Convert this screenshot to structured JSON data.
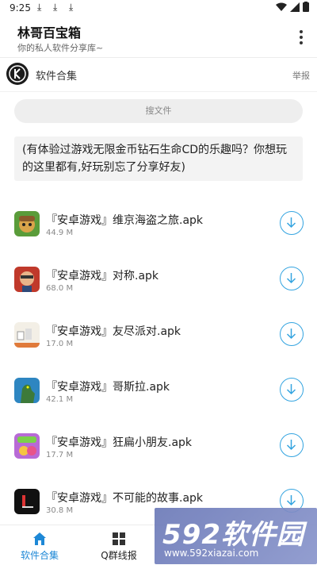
{
  "status_bar": {
    "time": "9:25"
  },
  "app": {
    "title": "林哥百宝箱",
    "subtitle": "你的私人软件分享库~"
  },
  "source": {
    "label": "软件合集",
    "report": "举报"
  },
  "search": {
    "placeholder": "搜文件"
  },
  "description": "(有体验过游戏无限金币钻石生命CD的乐趣吗？你想玩的这里都有,好玩别忘了分享好友)",
  "files": [
    {
      "name": "『安卓游戏』维京海盗之旅.apk",
      "size": "44.9 M",
      "icon": "viking-game-icon"
    },
    {
      "name": "『安卓游戏』对称.apk",
      "size": "68.0 M",
      "icon": "symmetry-game-icon"
    },
    {
      "name": "『安卓游戏』友尽派对.apk",
      "size": "17.0 M",
      "icon": "party-game-icon"
    },
    {
      "name": "『安卓游戏』哥斯拉.apk",
      "size": "42.1 M",
      "icon": "godzilla-game-icon"
    },
    {
      "name": "『安卓游戏』狂扁小朋友.apk",
      "size": "17.7 M",
      "icon": "kids-game-icon"
    },
    {
      "name": "『安卓游戏』不可能的故事.apk",
      "size": "30.8 M",
      "icon": "impossible-story-game-icon"
    }
  ],
  "bottom_nav": [
    {
      "label": "软件合集",
      "icon": "home-icon",
      "active": true
    },
    {
      "label": "Q群线报",
      "icon": "grid-icon",
      "active": false
    }
  ],
  "watermark": {
    "brand": "592软件园",
    "url": "www.592xiazai.com"
  },
  "colors": {
    "accent": "#1e88d6",
    "download": "#34a4e0"
  }
}
